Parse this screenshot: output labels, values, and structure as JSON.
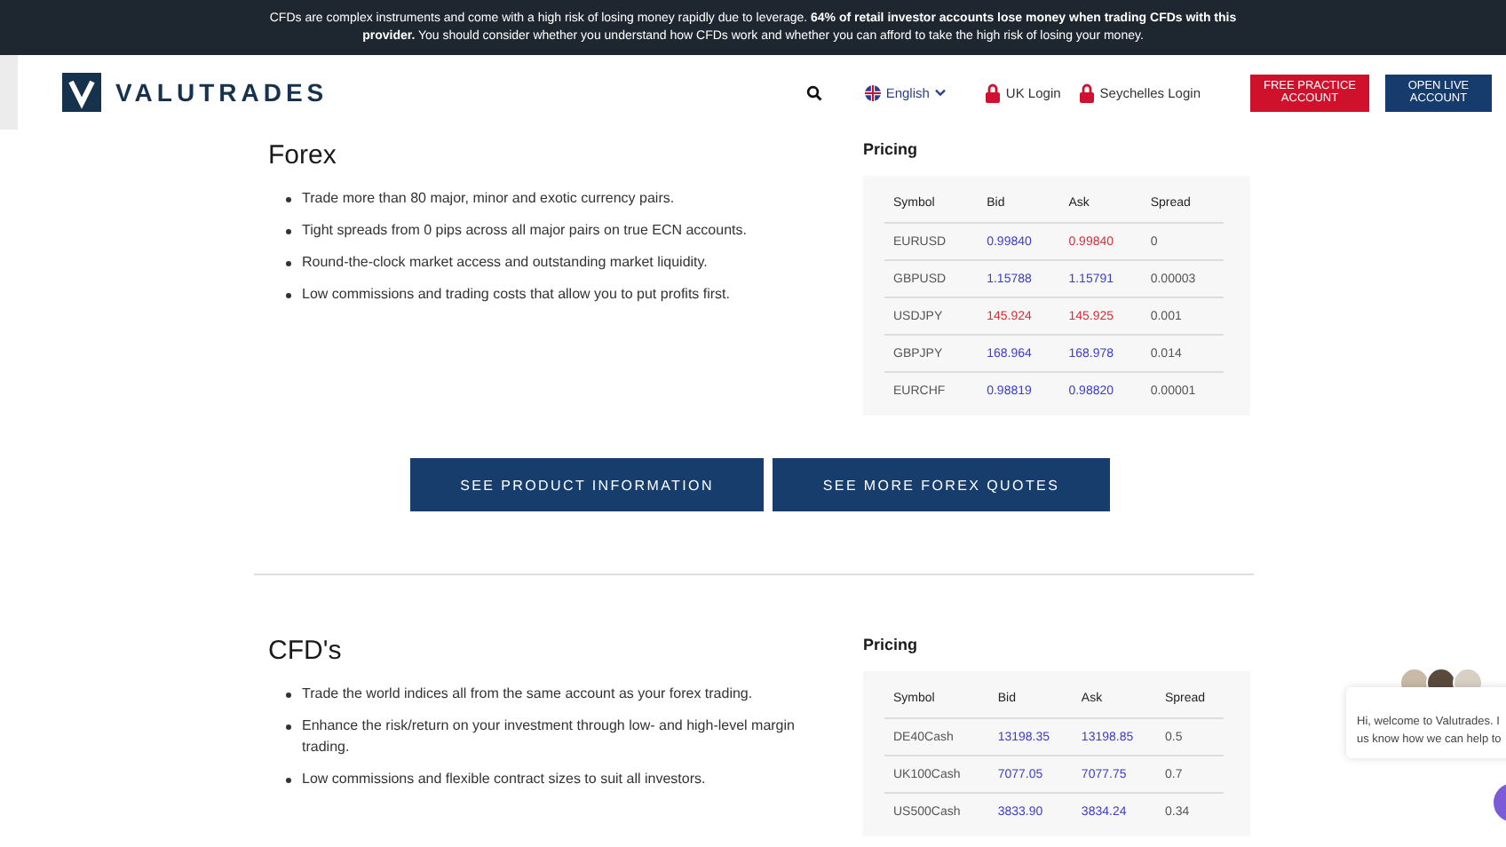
{
  "risk_banner": {
    "text": "CFDs are complex instruments and come with a high risk of losing money rapidly due to leverage. **64% of retail investor accounts lose money when trading CFDs with this provider.** You should consider whether you understand how CFDs work and whether you can afford to take the high risk of losing your money."
  },
  "header": {
    "logo_text": "VALUTRADES",
    "language": "English",
    "links": [
      "UK Login",
      "Seychelles Login"
    ],
    "buttons": [
      {
        "label": "FREE PRACTICE ACCOUNT",
        "kind": "red"
      },
      {
        "label": "OPEN LIVE ACCOUNT",
        "kind": "navy"
      }
    ]
  },
  "sections": [
    {
      "title": "Forex",
      "bullets": [
        "Trade more than 80 major, minor and exotic currency pairs.",
        "Tight spreads from 0 pips across all major pairs on true ECN accounts.",
        "Round-the-clock market access and outstanding market liquidity.",
        "Low commissions and trading costs that allow you to put profits first."
      ],
      "pricing": {
        "title": "Pricing",
        "columns": [
          "Symbol",
          "Bid",
          "Ask",
          "Spread"
        ],
        "rows": [
          {
            "symbol": "EURUSD",
            "bid": {
              "text": "0.99840",
              "color": "#3b3bcc"
            },
            "ask": {
              "text": "0.99840",
              "color": "#d32f3a"
            },
            "spread": "0"
          },
          {
            "symbol": "GBPUSD",
            "bid": {
              "text": "1.15788",
              "color": "#3b3bcc"
            },
            "ask": {
              "text": "1.15791",
              "color": "#3b3bcc"
            },
            "spread": "0.00003"
          },
          {
            "symbol": "USDJPY",
            "bid": {
              "text": "145.924",
              "color": "#d32f3a"
            },
            "ask": {
              "text": "145.925",
              "color": "#d32f3a"
            },
            "spread": "0.001"
          },
          {
            "symbol": "GBPJPY",
            "bid": {
              "text": "168.964",
              "color": "#3b3bcc"
            },
            "ask": {
              "text": "168.978",
              "color": "#3b3bcc"
            },
            "spread": "0.014"
          },
          {
            "symbol": "EURCHF",
            "bid": {
              "text": "0.98819",
              "color": "#3b3bcc"
            },
            "ask": {
              "text": "0.98820",
              "color": "#3b3bcc"
            },
            "spread": "0.00001"
          }
        ]
      },
      "buttons": [
        "SEE PRODUCT INFORMATION",
        "SEE MORE FOREX QUOTES"
      ]
    },
    {
      "title": "CFD's",
      "bullets": [
        "Trade the world indices all from the same account as your forex trading.",
        "Enhance the risk/return on your investment through low- and high-level margin trading.",
        "Low commissions and flexible contract sizes to suit all investors."
      ],
      "pricing": {
        "title": "Pricing",
        "columns": [
          "Symbol",
          "Bid",
          "Ask",
          "Spread"
        ],
        "rows": [
          {
            "symbol": "DE40Cash",
            "bid": {
              "text": "13198.35",
              "color": "#3b3bcc"
            },
            "ask": {
              "text": "13198.85",
              "color": "#3b3bcc"
            },
            "spread": "0.5"
          },
          {
            "symbol": "UK100Cash",
            "bid": {
              "text": "7077.05",
              "color": "#3b3bcc"
            },
            "ask": {
              "text": "7077.75",
              "color": "#3b3bcc"
            },
            "spread": "0.7"
          },
          {
            "symbol": "US500Cash",
            "bid": {
              "text": "3833.90",
              "color": "#3b3bcc"
            },
            "ask": {
              "text": "3834.24",
              "color": "#3b3bcc"
            },
            "spread": "0.34"
          }
        ]
      }
    }
  ],
  "chat_widget": {
    "lines": [
      "Hi, welcome to Valutrades. I",
      "us know how we can help to"
    ]
  }
}
